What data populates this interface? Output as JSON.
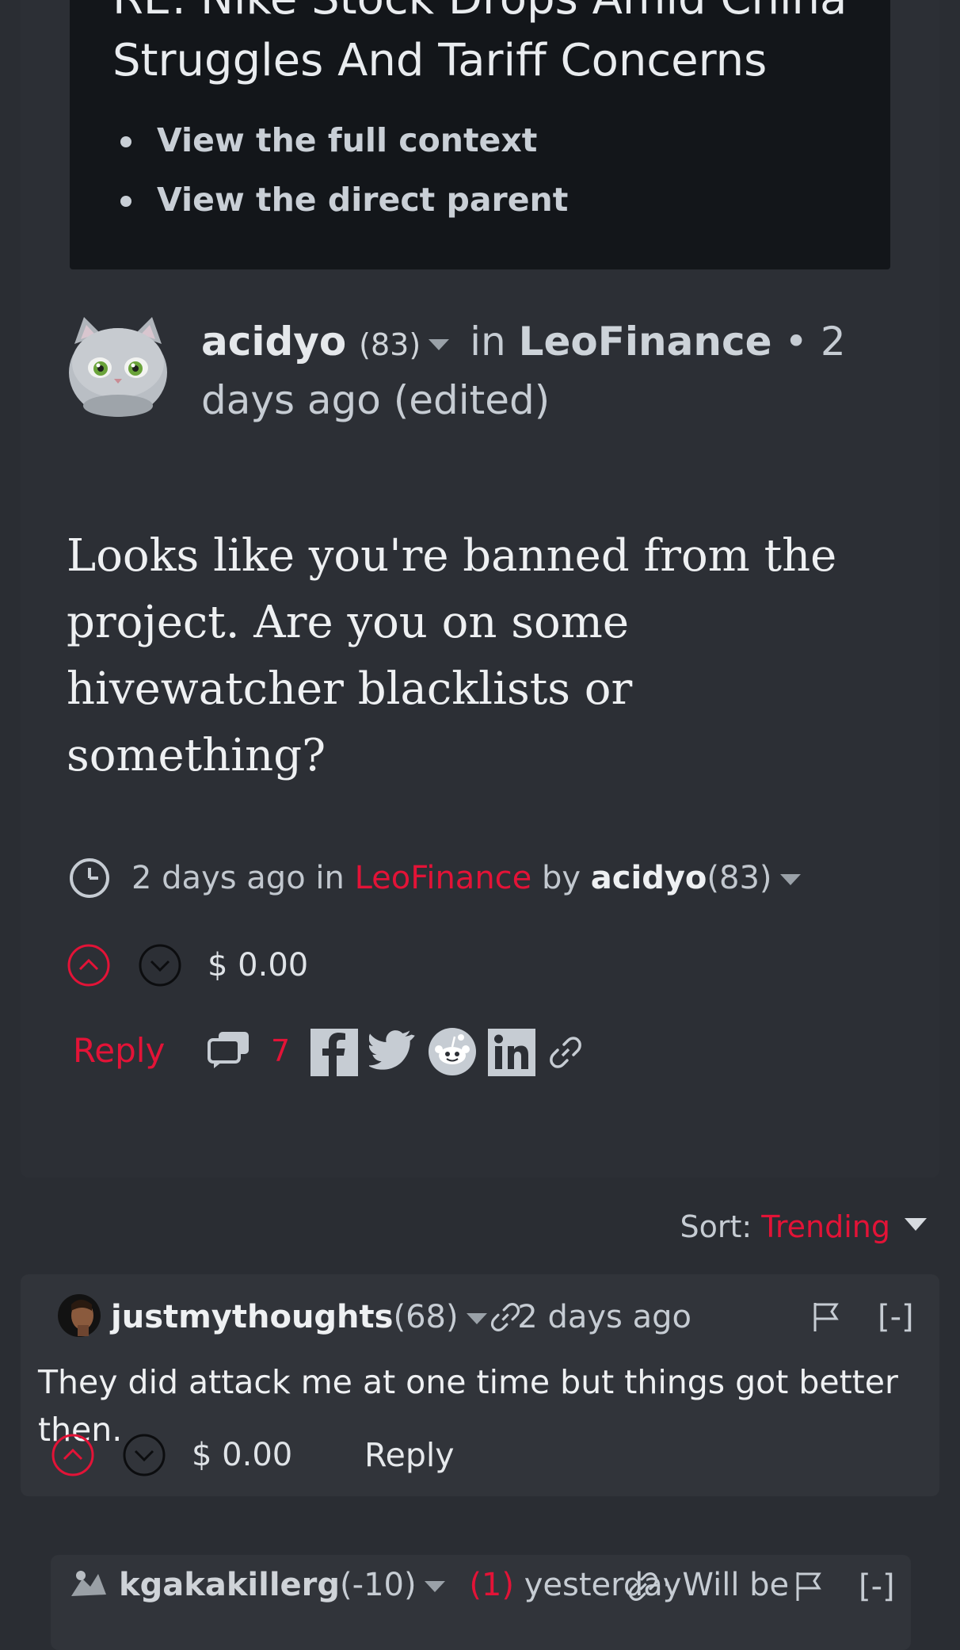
{
  "context": {
    "title": "RE: Nike Stock Drops Amid China Struggles And Tariff Concerns",
    "links": [
      "View the full context",
      "View the direct parent"
    ]
  },
  "post": {
    "author": "acidyo",
    "reputation": "(83)",
    "in_label": "in",
    "community": "LeoFinance",
    "separator": "•",
    "age": "2 days ago (edited)",
    "body": "Looks like you're banned from the project. Are you on some hivewatcher blacklists or something?",
    "meta": {
      "age": "2 days ago",
      "in_label": "in",
      "community": "LeoFinance",
      "by_label": "by",
      "author": "acidyo",
      "reputation": "(83)"
    },
    "payout": "$ 0.00",
    "reply_label": "Reply",
    "comment_count": "7",
    "icons": [
      "upvote-icon",
      "downvote-icon",
      "comments-icon",
      "facebook-icon",
      "twitter-icon",
      "reddit-icon",
      "linkedin-icon",
      "link-icon"
    ]
  },
  "sort": {
    "label": "Sort:",
    "selected": "Trending"
  },
  "comments": [
    {
      "author": "justmythoughts",
      "reputation": "(68)",
      "age": "2 days ago",
      "body": "They did attack me at one time but things got better then.",
      "payout": "$ 0.00",
      "reply_label": "Reply",
      "collapse": "[-]"
    },
    {
      "author": "kgakakillerg",
      "reputation": "(-10)",
      "muted_count": "(1)",
      "age": "yesterday",
      "extra": "· Will be",
      "collapse": "[-]"
    }
  ],
  "colors": {
    "accent": "#e31337",
    "background": "#2a2d33",
    "context_bg": "#13161a"
  }
}
